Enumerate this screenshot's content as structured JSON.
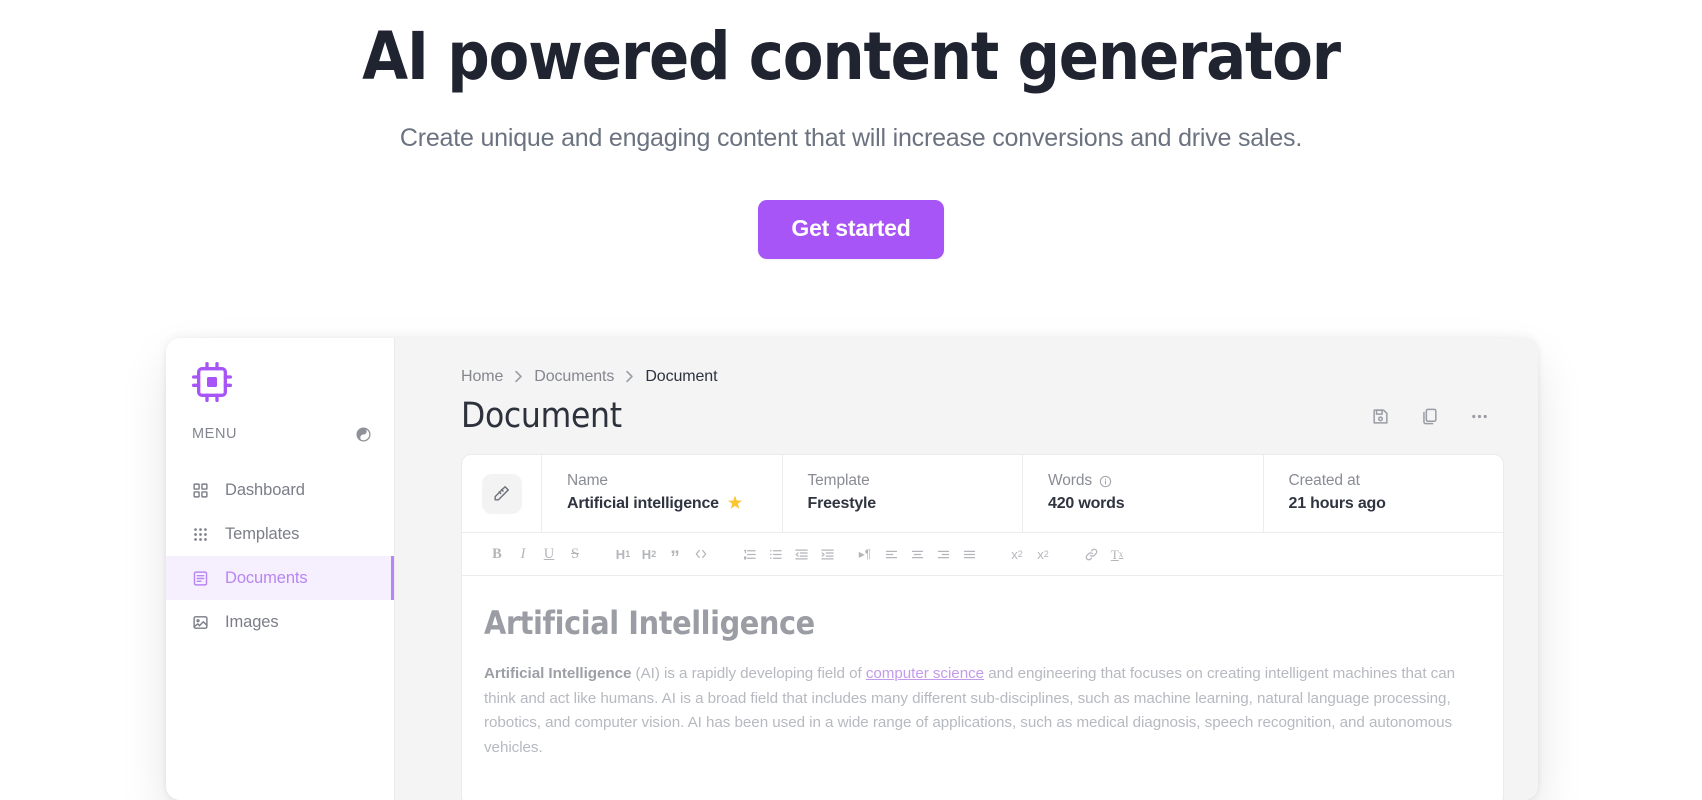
{
  "hero": {
    "title": "AI powered content generator",
    "subtitle": "Create unique and engaging content that will increase conversions and drive sales.",
    "cta_label": "Get started",
    "cta_color": "#a855f7"
  },
  "app": {
    "sidebar": {
      "logo_icon": "cpu-chip-icon",
      "logo_color": "#a855f7",
      "menu_label": "MENU",
      "theme_toggle_icon": "contrast-circle-icon",
      "items": [
        {
          "label": "Dashboard",
          "icon": "grid-2x2-icon",
          "active": false
        },
        {
          "label": "Templates",
          "icon": "grid-dots-icon",
          "active": false
        },
        {
          "label": "Documents",
          "icon": "document-list-icon",
          "active": true
        },
        {
          "label": "Images",
          "icon": "image-icon",
          "active": false
        }
      ],
      "active_color": "#b886f3",
      "active_bg": "#f6effe"
    },
    "breadcrumb": [
      {
        "label": "Home",
        "current": false
      },
      {
        "label": "Documents",
        "current": false
      },
      {
        "label": "Document",
        "current": true
      }
    ],
    "page_title": "Document",
    "title_actions": [
      {
        "icon": "save-icon",
        "name": "save-button"
      },
      {
        "icon": "copy-icon",
        "name": "copy-button"
      },
      {
        "icon": "more-horizontal-icon",
        "name": "more-button"
      }
    ],
    "meta": {
      "edit_icon": "magic-pen-icon",
      "fields": [
        {
          "key": "Name",
          "value": "Artificial intelligence",
          "starred": true,
          "info": false
        },
        {
          "key": "Template",
          "value": "Freestyle",
          "starred": false,
          "info": false
        },
        {
          "key": "Words",
          "value": "420 words",
          "starred": false,
          "info": true
        },
        {
          "key": "Created at",
          "value": "21 hours ago",
          "starred": false,
          "info": false
        }
      ]
    },
    "toolbar": [
      {
        "name": "bold-button",
        "glyph": "B",
        "type": "text",
        "style": "bold"
      },
      {
        "name": "italic-button",
        "glyph": "I",
        "type": "text",
        "style": "italic"
      },
      {
        "name": "underline-button",
        "glyph": "U",
        "type": "text",
        "style": "underline"
      },
      {
        "name": "strikethrough-button",
        "glyph": "S",
        "type": "text",
        "style": "strike"
      },
      {
        "name": "heading-1-button",
        "glyph": "H1",
        "type": "svg"
      },
      {
        "name": "heading-2-button",
        "glyph": "H2",
        "type": "svg"
      },
      {
        "name": "blockquote-button",
        "glyph": "”",
        "type": "text",
        "style": "quote"
      },
      {
        "name": "code-block-button",
        "glyph": "</>",
        "type": "svg"
      },
      {
        "name": "ordered-list-button",
        "glyph": "ordered-list-icon",
        "type": "svg"
      },
      {
        "name": "bullet-list-button",
        "glyph": "bullet-list-icon",
        "type": "svg"
      },
      {
        "name": "outdent-button",
        "glyph": "outdent-icon",
        "type": "svg"
      },
      {
        "name": "indent-button",
        "glyph": "indent-icon",
        "type": "svg"
      },
      {
        "name": "text-direction-button",
        "glyph": "paragraph-direction-icon",
        "type": "svg"
      },
      {
        "name": "align-left-button",
        "glyph": "align-left-icon",
        "type": "svg"
      },
      {
        "name": "align-center-button",
        "glyph": "align-center-icon",
        "type": "svg"
      },
      {
        "name": "align-right-button",
        "glyph": "align-right-icon",
        "type": "svg"
      },
      {
        "name": "align-justify-button",
        "glyph": "align-justify-icon",
        "type": "svg"
      },
      {
        "name": "subscript-button",
        "glyph": "x2sub",
        "type": "svg"
      },
      {
        "name": "superscript-button",
        "glyph": "x2sup",
        "type": "svg"
      },
      {
        "name": "link-button",
        "glyph": "link-icon",
        "type": "svg"
      },
      {
        "name": "clear-format-button",
        "glyph": "clear-format-icon",
        "type": "svg"
      }
    ],
    "document": {
      "heading": "Artificial Intelligence",
      "paragraph": {
        "lead": "Artificial Intelligence",
        "before_link": " (AI) is a rapidly developing field of ",
        "link": "computer science",
        "after_link": " and engineering that focuses on creating intelligent machines that can think and act like humans. AI is a broad field that includes many different sub-disciplines, such as machine learning, natural language processing, robotics, and computer vision. AI has been used in a wide range of applications, such as medical diagnosis, speech recognition, and autonomous vehicles."
      }
    }
  }
}
